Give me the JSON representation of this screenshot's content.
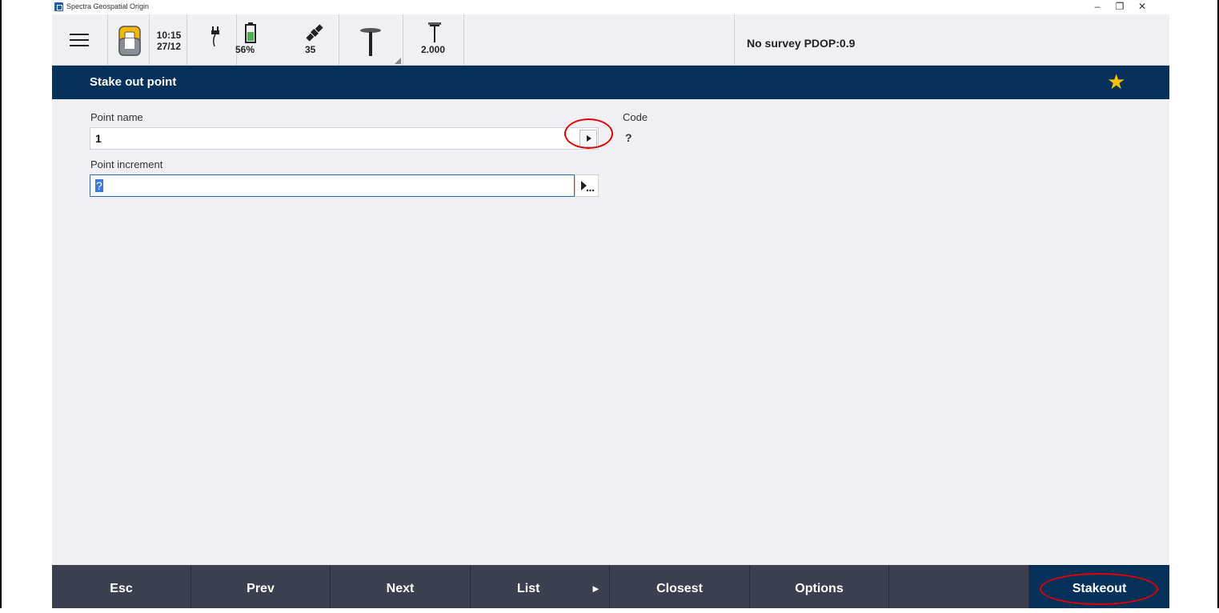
{
  "window": {
    "title": "Spectra Geospatial Origin",
    "controls": {
      "minimize": "–",
      "restore": "❐",
      "close": "✕"
    }
  },
  "statusbar": {
    "time": "10:15",
    "date": "27/12",
    "battery_percent": "56%",
    "satellites": "35",
    "antenna_height": "2.000",
    "status_text": "No survey  PDOP:0.9"
  },
  "page": {
    "title": "Stake out point"
  },
  "form": {
    "point_name_label": "Point name",
    "point_name_value": "1",
    "code_label": "Code",
    "code_value": "?",
    "point_increment_label": "Point increment",
    "point_increment_value": "?"
  },
  "bottombar": {
    "esc": "Esc",
    "prev": "Prev",
    "next": "Next",
    "list": "List",
    "list_arrow": "►",
    "closest": "Closest",
    "options": "Options",
    "stakeout": "Stakeout"
  },
  "colors": {
    "header_bg": "#06315a",
    "bottombar_bg": "#3c3f50",
    "star": "#ffc000",
    "annotation": "#e00000",
    "content_bg": "#efeff4"
  }
}
